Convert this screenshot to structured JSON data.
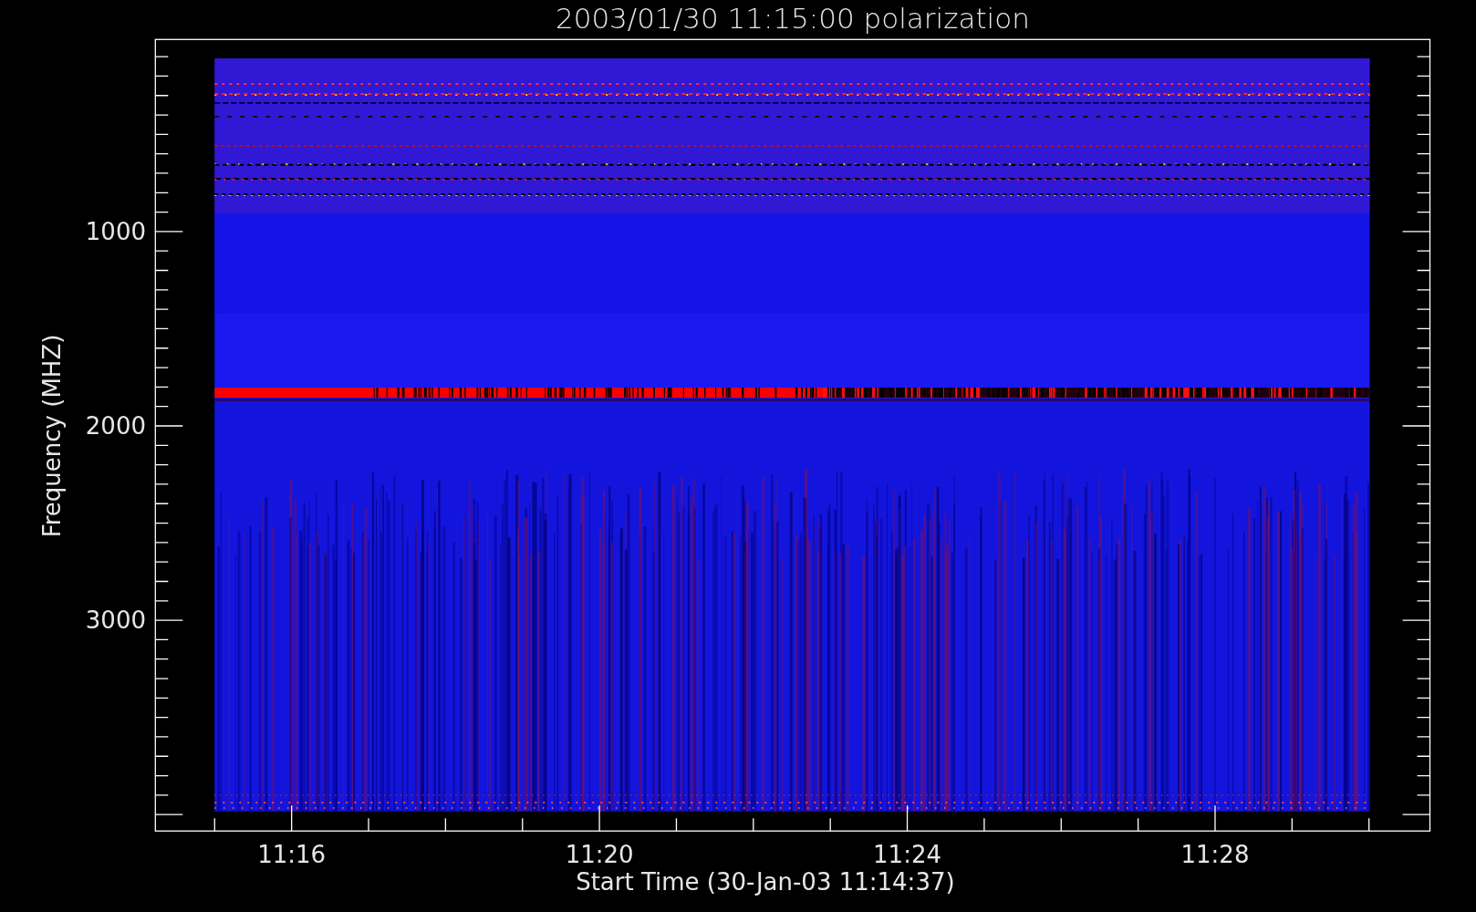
{
  "chart": {
    "title": "2003/01/30 11:15:00 polarization",
    "xlabel": "Start Time (30-Jan-03 11:14:37)",
    "ylabel": "Frequency (MHZ)",
    "xticks": [
      "11:16",
      "11:20",
      "11:24",
      "11:28"
    ],
    "yticks": [
      "1000",
      "2000",
      "3000"
    ]
  }
}
